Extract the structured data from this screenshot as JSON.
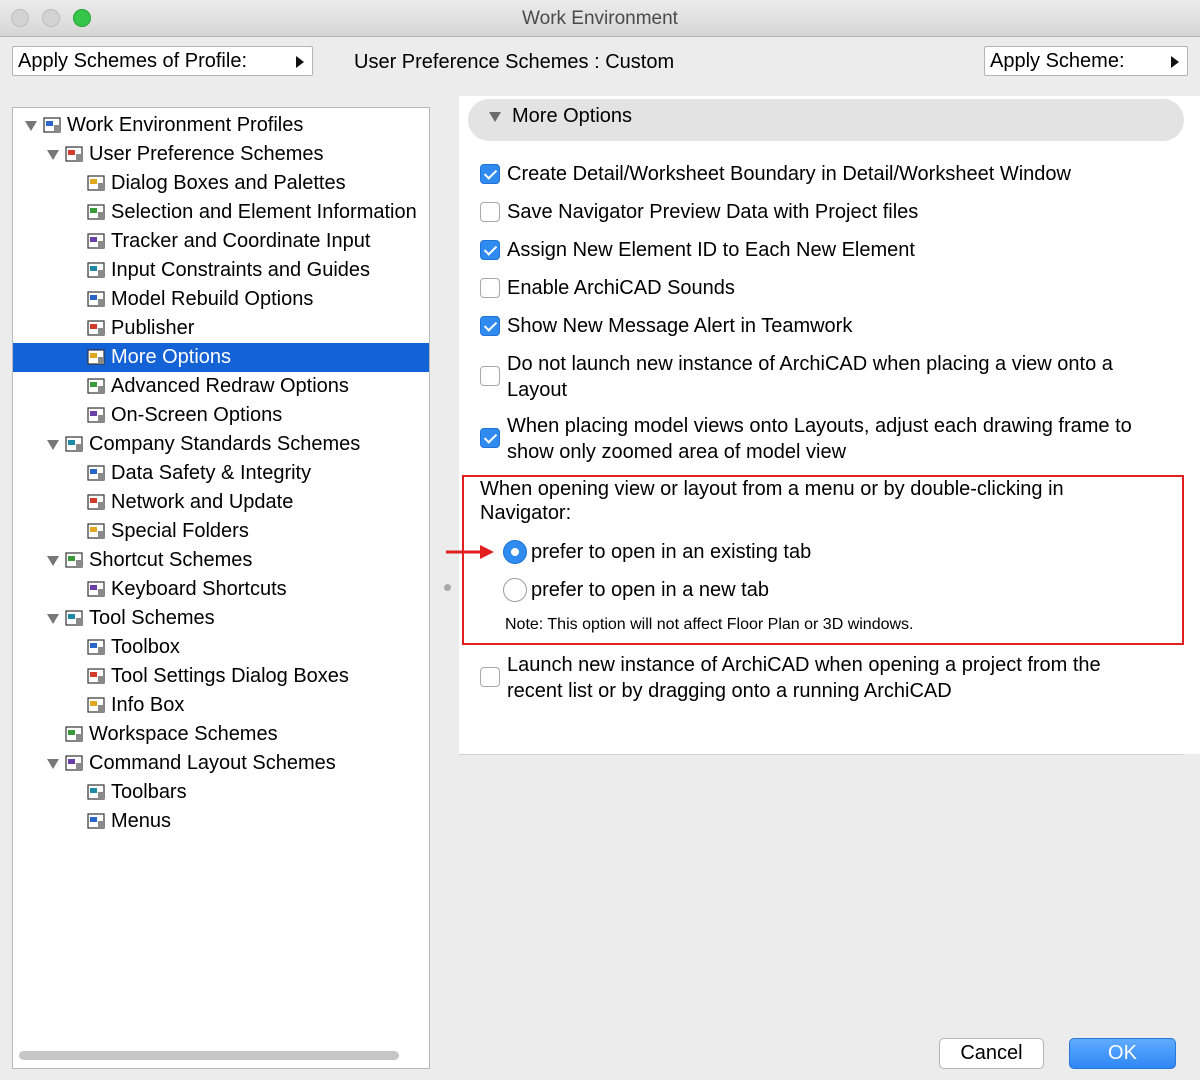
{
  "window": {
    "title": "Work Environment"
  },
  "header": {
    "apply_profile_label": "Apply Schemes of Profile:",
    "scheme_label": "User Preference Schemes : Custom",
    "apply_scheme_label": "Apply Scheme:"
  },
  "tree": {
    "items": [
      {
        "label": "Work Environment Profiles",
        "icon": "profiles-icon"
      },
      {
        "label": "User Preference Schemes",
        "icon": "user-pref-icon"
      },
      {
        "label": "Dialog Boxes and Palettes",
        "icon": "dialog-boxes-icon"
      },
      {
        "label": "Selection and Element Information",
        "icon": "selection-icon"
      },
      {
        "label": "Tracker and Coordinate Input",
        "icon": "tracker-icon"
      },
      {
        "label": "Input Constraints and Guides",
        "icon": "constraints-icon"
      },
      {
        "label": "Model Rebuild Options",
        "icon": "model-rebuild-icon"
      },
      {
        "label": "Publisher",
        "icon": "publisher-icon"
      },
      {
        "label": "More Options",
        "icon": "more-options-icon"
      },
      {
        "label": "Advanced Redraw Options",
        "icon": "redraw-icon"
      },
      {
        "label": "On-Screen Options",
        "icon": "onscreen-icon"
      },
      {
        "label": "Company Standards Schemes",
        "icon": "company-icon"
      },
      {
        "label": "Data Safety & Integrity",
        "icon": "data-safety-icon"
      },
      {
        "label": "Network and Update",
        "icon": "network-icon"
      },
      {
        "label": "Special Folders",
        "icon": "folders-icon"
      },
      {
        "label": "Shortcut Schemes",
        "icon": "shortcut-schemes-icon"
      },
      {
        "label": "Keyboard Shortcuts",
        "icon": "keyboard-icon"
      },
      {
        "label": "Tool Schemes",
        "icon": "tool-schemes-icon"
      },
      {
        "label": "Toolbox",
        "icon": "toolbox-icon"
      },
      {
        "label": "Tool Settings Dialog Boxes",
        "icon": "tool-settings-icon"
      },
      {
        "label": "Info Box",
        "icon": "info-box-icon"
      },
      {
        "label": "Workspace Schemes",
        "icon": "workspace-icon"
      },
      {
        "label": "Command Layout Schemes",
        "icon": "command-layout-icon"
      },
      {
        "label": "Toolbars",
        "icon": "toolbars-icon"
      },
      {
        "label": "Menus",
        "icon": "menus-icon"
      }
    ],
    "selected": "More Options"
  },
  "panel": {
    "section_title": "More Options",
    "options": [
      {
        "line1": "Create Detail/Worksheet Boundary in Detail/Worksheet Window",
        "line2": "",
        "checked": true
      },
      {
        "line1": "Save Navigator Preview Data with Project files",
        "line2": "",
        "checked": false
      },
      {
        "line1": "Assign New Element ID to Each New Element",
        "line2": "",
        "checked": true
      },
      {
        "line1": "Enable ArchiCAD Sounds",
        "line2": "",
        "checked": false
      },
      {
        "line1": "Show New Message Alert in Teamwork",
        "line2": "",
        "checked": true
      },
      {
        "line1": "Do not launch new instance of ArchiCAD when placing a view onto a",
        "line2": "Layout",
        "checked": false
      },
      {
        "line1": "When placing model views onto Layouts, adjust each drawing frame to",
        "line2": "show only zoomed area of model view",
        "checked": true
      }
    ],
    "open_view": {
      "title_line1": "When opening view or layout from a menu or by double-clicking in",
      "title_line2": "Navigator:",
      "radio_existing": "prefer to open in an existing tab",
      "radio_new": "prefer to open in a new tab",
      "selected": "existing",
      "note": "Note: This option will not affect Floor Plan or 3D windows."
    },
    "launch_option": {
      "line1": "Launch new instance of ArchiCAD when opening a project from the",
      "line2": "recent list or by dragging onto a running ArchiCAD",
      "checked": false
    }
  },
  "buttons": {
    "cancel": "Cancel",
    "ok": "OK"
  }
}
